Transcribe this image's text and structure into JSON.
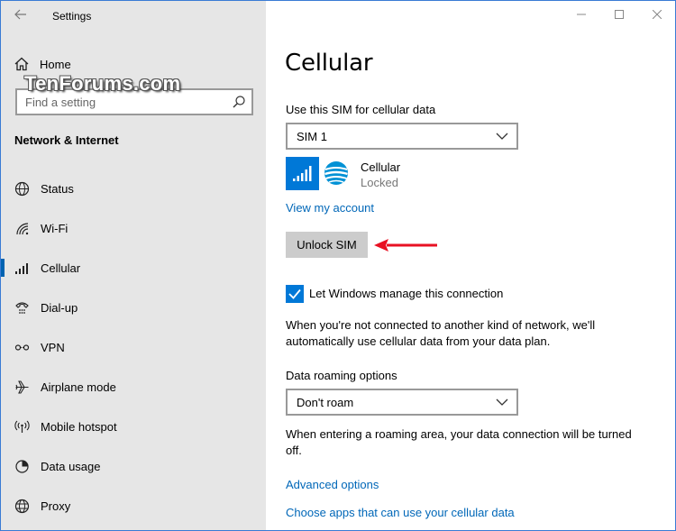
{
  "window": {
    "title": "Settings"
  },
  "sidebar": {
    "home_label": "Home",
    "search_placeholder": "Find a setting",
    "watermark": "TenForums.com",
    "section_title": "Network & Internet",
    "items": [
      {
        "label": "Status",
        "icon": "globe-icon",
        "active": false
      },
      {
        "label": "Wi-Fi",
        "icon": "wifi-icon",
        "active": false
      },
      {
        "label": "Cellular",
        "icon": "cellular-signal-icon",
        "active": true
      },
      {
        "label": "Dial-up",
        "icon": "dialup-phone-icon",
        "active": false
      },
      {
        "label": "VPN",
        "icon": "vpn-icon",
        "active": false
      },
      {
        "label": "Airplane mode",
        "icon": "airplane-icon",
        "active": false
      },
      {
        "label": "Mobile hotspot",
        "icon": "hotspot-icon",
        "active": false
      },
      {
        "label": "Data usage",
        "icon": "data-usage-icon",
        "active": false
      },
      {
        "label": "Proxy",
        "icon": "proxy-globe-icon",
        "active": false
      }
    ]
  },
  "main": {
    "title": "Cellular",
    "sim_label": "Use this SIM for cellular data",
    "sim_selected": "SIM 1",
    "carrier_name": "Cellular",
    "carrier_status": "Locked",
    "view_account_link": "View my account",
    "unlock_button": "Unlock SIM",
    "manage_checkbox_label": "Let Windows manage this connection",
    "manage_checked": true,
    "manage_description": "When you're not connected to another kind of network, we'll automatically use cellular data from your data plan.",
    "roaming_label": "Data roaming options",
    "roaming_selected": "Don't roam",
    "roaming_description": "When entering a roaming area, your data connection will be turned off.",
    "advanced_link": "Advanced options",
    "choose_apps_link": "Choose apps that can use your cellular data"
  },
  "colors": {
    "accent": "#0078d7",
    "link": "#0067b8",
    "sidebar_bg": "#e6e6e6",
    "annotation_arrow": "#e81123"
  }
}
